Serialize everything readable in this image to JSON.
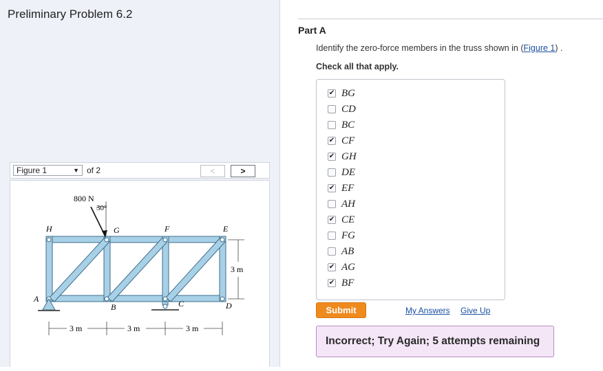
{
  "left": {
    "title": "Preliminary Problem 6.2",
    "figure_select": "Figure 1",
    "figure_of": "of 2",
    "prev_label": "<",
    "next_label": ">"
  },
  "figure": {
    "load_label": "800 N",
    "angle_label": "30°",
    "nodes": {
      "A": "A",
      "B": "B",
      "C": "C",
      "D": "D",
      "E": "E",
      "F": "F",
      "G": "G",
      "H": "H"
    },
    "dim_1": "3 m",
    "dim_2": "3 m",
    "dim_3": "3 m",
    "dim_height": "3 m"
  },
  "part": {
    "label": "Part A",
    "question_prefix": "Identify the zero-force members in the truss shown in (",
    "question_link": "Figure 1",
    "question_suffix": ") .",
    "instruction": "Check all that apply."
  },
  "options": [
    {
      "label": "BG",
      "checked": true
    },
    {
      "label": "CD",
      "checked": false
    },
    {
      "label": "BC",
      "checked": false
    },
    {
      "label": "CF",
      "checked": true
    },
    {
      "label": "GH",
      "checked": true
    },
    {
      "label": "DE",
      "checked": false
    },
    {
      "label": "EF",
      "checked": true
    },
    {
      "label": "AH",
      "checked": false
    },
    {
      "label": "CE",
      "checked": true
    },
    {
      "label": "FG",
      "checked": false
    },
    {
      "label": "AB",
      "checked": false
    },
    {
      "label": "AG",
      "checked": true
    },
    {
      "label": "BF",
      "checked": true
    }
  ],
  "actions": {
    "submit": "Submit",
    "my_answers": "My Answers",
    "give_up": "Give Up"
  },
  "feedback": "Incorrect; Try Again; 5 attempts remaining",
  "colors": {
    "accent": "#ef8a1e",
    "link": "#1a4fa0",
    "member_fill": "#a8d0e6",
    "member_stroke": "#3d6e8c",
    "feedback_bg": "#f4e6f7"
  }
}
